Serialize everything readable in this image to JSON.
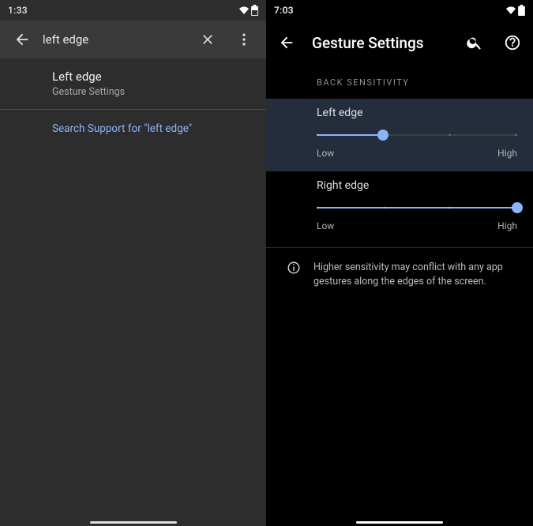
{
  "left": {
    "status_time": "1:33",
    "search_query": "left edge",
    "result": {
      "title": "Left edge",
      "subtitle": "Gesture Settings"
    },
    "support_link": "Search Support for \"left edge\""
  },
  "right": {
    "status_time": "7:03",
    "appbar_title": "Gesture Settings",
    "section_label": "BACK SENSITIVITY",
    "sliders": {
      "left_edge": {
        "label": "Left edge",
        "low": "Low",
        "high": "High",
        "value_pct": 33
      },
      "right_edge": {
        "label": "Right edge",
        "low": "Low",
        "high": "High",
        "value_pct": 100
      }
    },
    "info_text": "Higher sensitivity may conflict with any app gestures along the edges of the screen."
  }
}
